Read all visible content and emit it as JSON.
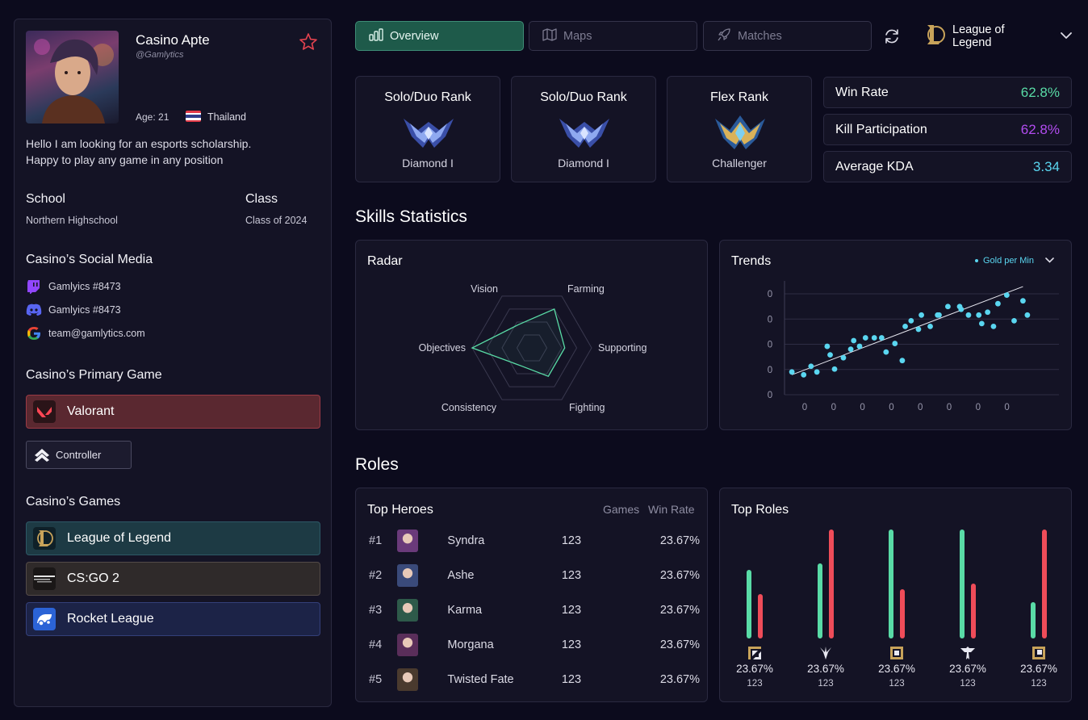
{
  "profile": {
    "name": "Casino Apte",
    "handle": "@Gamlytics",
    "age": "Age: 21",
    "country": "Thailand",
    "bio_line1": "Hello I am looking for an esports scholarship.",
    "bio_line2": "Happy to play any game in any position",
    "school_label": "School",
    "school_value": "Northern Highschool",
    "class_label": "Class",
    "class_value": "Class of 2024",
    "social_title": "Casino’s Social Media",
    "socials": [
      {
        "icon": "twitch-icon",
        "label": "Gamlyics #8473"
      },
      {
        "icon": "discord-icon",
        "label": "Gamlyics #8473"
      },
      {
        "icon": "google-icon",
        "label": "team@gamlytics.com"
      }
    ],
    "primary_title": "Casino’s Primary Game",
    "primary_game": "Valorant",
    "role_badge": "Controller",
    "games_title": "Casino’s Games",
    "games": [
      {
        "label": "League of Legend",
        "color": "#1d3a44"
      },
      {
        "label": "CS:GO 2",
        "color": "#2f2a2a"
      },
      {
        "label": "Rocket League",
        "color": "#1c2347"
      }
    ]
  },
  "tabs": [
    {
      "label": "Overview",
      "icon": "bar-chart-icon"
    },
    {
      "label": "Maps",
      "icon": "map-icon"
    },
    {
      "label": "Matches",
      "icon": "rocket-icon"
    }
  ],
  "game_select": {
    "label": "League of Legend"
  },
  "ranks": [
    {
      "title": "Solo/Duo Rank",
      "tier": "Diamond I"
    },
    {
      "title": "Solo/Duo Rank",
      "tier": "Diamond I"
    },
    {
      "title": "Flex Rank",
      "tier": "Challenger"
    }
  ],
  "stats": [
    {
      "label": "Win Rate",
      "value": "62.8%",
      "color": "#59dba6"
    },
    {
      "label": "Kill Participation",
      "value": "62.8%",
      "color": "#b24cf0"
    },
    {
      "label": "Average KDA",
      "value": "3.34",
      "color": "#5ad6f0"
    }
  ],
  "skills_title": "Skills Statistics",
  "radar": {
    "title": "Radar",
    "axes": [
      "Vision",
      "Farming",
      "Supporting",
      "Fighting",
      "Consistency",
      "Objectives"
    ],
    "values": [
      0.45,
      0.75,
      0.55,
      0.55,
      0.35,
      1.0
    ]
  },
  "trends": {
    "title": "Trends",
    "legend": "Gold per Min",
    "y_ticks": [
      "0",
      "0",
      "0",
      "0",
      "0"
    ],
    "x_ticks": [
      "0",
      "0",
      "0",
      "0",
      "0",
      "0",
      "0",
      "0"
    ]
  },
  "chart_data": {
    "type": "scatter",
    "title": "Trends",
    "series": [
      {
        "name": "Gold per Min",
        "x": [
          0.5,
          1.3,
          1.8,
          2.2,
          2.9,
          3.1,
          3.4,
          4.0,
          4.5,
          4.7,
          5.1,
          5.5,
          6.1,
          6.6,
          6.9,
          7.5,
          8.0,
          8.2,
          8.6,
          9.1,
          9.3,
          9.9,
          10.4,
          10.5,
          11.1,
          11.9,
          12.0,
          12.5,
          13.2,
          13.4,
          13.8,
          14.2,
          14.5,
          15.1,
          15.6,
          16.2,
          16.5
        ],
        "y": [
          0.8,
          0.7,
          1.0,
          0.8,
          1.7,
          1.4,
          0.9,
          1.3,
          1.6,
          1.9,
          1.7,
          2.0,
          2.0,
          2.0,
          1.5,
          1.8,
          1.2,
          2.4,
          2.6,
          2.3,
          2.8,
          2.4,
          2.8,
          2.8,
          3.1,
          3.1,
          3.0,
          2.8,
          2.8,
          2.5,
          2.9,
          2.4,
          3.2,
          3.5,
          2.6,
          3.3,
          2.8
        ]
      }
    ],
    "trendline": {
      "x": [
        0.5,
        16.2
      ],
      "y": [
        0.7,
        3.8
      ]
    },
    "ylim": [
      0,
      4
    ],
    "xlim": [
      0,
      17
    ]
  },
  "roles_title": "Roles",
  "heroes": {
    "title": "Top Heroes",
    "col_games": "Games",
    "col_winrate": "Win Rate",
    "rows": [
      {
        "rank": "#1",
        "name": "Syndra",
        "games": "123",
        "wr": "23.67%",
        "color": "#6a3a7a"
      },
      {
        "rank": "#2",
        "name": "Ashe",
        "games": "123",
        "wr": "23.67%",
        "color": "#3a4a7a"
      },
      {
        "rank": "#3",
        "name": "Karma",
        "games": "123",
        "wr": "23.67%",
        "color": "#2e5a4a"
      },
      {
        "rank": "#4",
        "name": "Morgana",
        "games": "123",
        "wr": "23.67%",
        "color": "#5a2e5a"
      },
      {
        "rank": "#5",
        "name": "Twisted Fate",
        "games": "123",
        "wr": "23.67%",
        "color": "#4a3a2e"
      }
    ]
  },
  "roles": {
    "title": "Top Roles",
    "items": [
      {
        "icon": "top-role-icon",
        "pct": "23.67%",
        "games": "123",
        "green": 0.63,
        "red": 0.41
      },
      {
        "icon": "jungle-role-icon",
        "pct": "23.67%",
        "games": "123",
        "green": 0.69,
        "red": 1.0
      },
      {
        "icon": "mid-role-icon",
        "pct": "23.67%",
        "games": "123",
        "green": 1.0,
        "red": 0.45
      },
      {
        "icon": "support-role-icon",
        "pct": "23.67%",
        "games": "123",
        "green": 1.0,
        "red": 0.5
      },
      {
        "icon": "bottom-role-icon",
        "pct": "23.67%",
        "games": "123",
        "green": 0.33,
        "red": 1.0
      }
    ]
  }
}
